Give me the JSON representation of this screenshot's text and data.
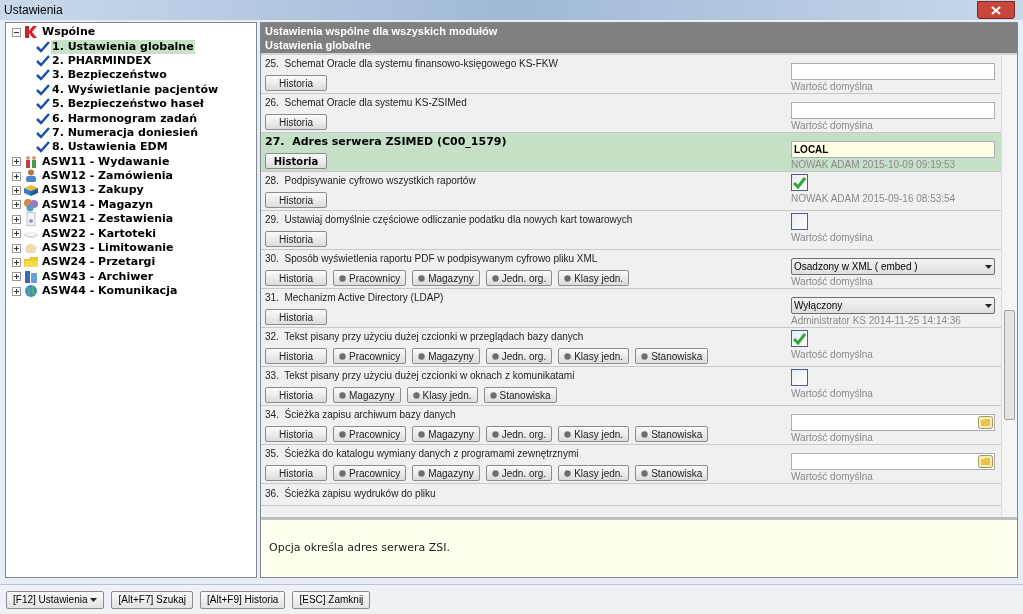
{
  "window": {
    "title": "Ustawienia"
  },
  "tree": [
    {
      "label": "Wspólne",
      "expanded": true,
      "children": [
        {
          "label": "1. Ustawienia globalne",
          "checked": true,
          "selected": true
        },
        {
          "label": "2. PHARMINDEX",
          "checked": true,
          "selected": false
        },
        {
          "label": "3. Bezpieczeństwo",
          "checked": true,
          "selected": false
        },
        {
          "label": "4. Wyświetlanie pacjentów",
          "checked": true,
          "selected": false
        },
        {
          "label": "5. Bezpieczeństwo haseł",
          "checked": true,
          "selected": false
        },
        {
          "label": "6. Harmonogram zadań",
          "checked": true,
          "selected": false
        },
        {
          "label": "7. Numeracja doniesień",
          "checked": true,
          "selected": false
        },
        {
          "label": "8. Ustawienia EDM",
          "checked": true,
          "selected": false
        }
      ]
    },
    {
      "label": "ASW11 - Wydawanie",
      "expanded": false
    },
    {
      "label": "ASW12 - Zamówienia",
      "expanded": false
    },
    {
      "label": "ASW13 - Zakupy",
      "expanded": false
    },
    {
      "label": "ASW14 - Magazyn",
      "expanded": false
    },
    {
      "label": "ASW21 - Zestawienia",
      "expanded": false
    },
    {
      "label": "ASW22 - Kartoteki",
      "expanded": false
    },
    {
      "label": "ASW23 - Limitowanie",
      "expanded": false
    },
    {
      "label": "ASW24 - Przetargi",
      "expanded": false
    },
    {
      "label": "ASW43 - Archiwer",
      "expanded": false
    },
    {
      "label": "ASW44 - Komunikacja",
      "expanded": false
    }
  ],
  "header": {
    "line_1": "Ustawienia wspólne dla wszyskich modułów",
    "line_2": "Ustawienia globalne"
  },
  "settings": [
    {
      "label": "25.  Schemat Oracle dla systemu finansowo-księgowego KS-FKW",
      "selected": false,
      "buttons": [
        {
          "label": "Historia",
          "kind": "history"
        }
      ],
      "control": {
        "kind": "text"
      },
      "note": "Wartość domyślna"
    },
    {
      "label": "26.  Schemat Oracle dla systemu KS-ZSIMed",
      "selected": false,
      "buttons": [
        {
          "label": "Historia",
          "kind": "history"
        }
      ],
      "control": {
        "kind": "text"
      },
      "note": "Wartość domyślna"
    },
    {
      "label": "27.  Adres serwera ZSIMED (C00_1579)",
      "selected": true,
      "buttons": [
        {
          "label": "Historia",
          "kind": "history"
        }
      ],
      "control": {
        "kind": "text",
        "value": "LOCAL"
      },
      "note": "NOWAK ADAM 2015-10-09 09:19:53"
    },
    {
      "label": "28.  Podpisywanie cyfrowo wszystkich raportów",
      "selected": false,
      "buttons": [
        {
          "label": "Historia",
          "kind": "history"
        }
      ],
      "control": {
        "kind": "checkbox",
        "checked": true
      },
      "note": "NOWAK ADAM 2015-09-16 08:53:54"
    },
    {
      "label": "29.  Ustawiaj domyślnie częściowe odliczanie podatku dla nowych kart towarowych",
      "selected": false,
      "buttons": [
        {
          "label": "Historia",
          "kind": "history"
        }
      ],
      "control": {
        "kind": "checkbox",
        "checked": false
      },
      "note": "Wartość domyślna"
    },
    {
      "label": "30.  Sposób wyświetlenia raportu PDF w podpisywanym cyfrowo pliku XML",
      "selected": false,
      "buttons": [
        {
          "label": "Historia",
          "kind": "history"
        },
        {
          "label": "Pracownicy",
          "kind": "scope"
        },
        {
          "label": "Magazyny",
          "kind": "scope"
        },
        {
          "label": "Jedn. org.",
          "kind": "scope"
        },
        {
          "label": "Klasy jedn.",
          "kind": "scope"
        }
      ],
      "control": {
        "kind": "select",
        "value": "Osadzony w XML ( embed )"
      },
      "note": "Wartość domyślna"
    },
    {
      "label": "31.  Mechanizm Active Directory (LDAP)",
      "selected": false,
      "buttons": [
        {
          "label": "Historia",
          "kind": "history"
        }
      ],
      "control": {
        "kind": "select",
        "value": "Wyłączony"
      },
      "note": "Administrator KS 2014-11-25 14:14:36"
    },
    {
      "label": "32.  Tekst pisany przy użyciu dużej czcionki w przeglądach bazy danych",
      "selected": false,
      "buttons": [
        {
          "label": "Historia",
          "kind": "history"
        },
        {
          "label": "Pracownicy",
          "kind": "scope"
        },
        {
          "label": "Magazyny",
          "kind": "scope"
        },
        {
          "label": "Jedn. org.",
          "kind": "scope"
        },
        {
          "label": "Klasy jedn.",
          "kind": "scope"
        },
        {
          "label": "Stanowiska",
          "kind": "scope"
        }
      ],
      "control": {
        "kind": "checkbox",
        "checked": true
      },
      "note": "Wartość domyślna"
    },
    {
      "label": "33.  Tekst pisany przy użyciu dużej czcionki w oknach z komunikatami",
      "selected": false,
      "buttons": [
        {
          "label": "Historia",
          "kind": "history"
        },
        {
          "label": "Magazyny",
          "kind": "scope"
        },
        {
          "label": "Klasy jedn.",
          "kind": "scope"
        },
        {
          "label": "Stanowiska",
          "kind": "scope"
        }
      ],
      "control": {
        "kind": "checkbox",
        "checked": false
      },
      "note": "Wartość domyślna"
    },
    {
      "label": "34.  Ścieżka zapisu archiwum bazy danych",
      "selected": false,
      "buttons": [
        {
          "label": "Historia",
          "kind": "history"
        },
        {
          "label": "Pracownicy",
          "kind": "scope"
        },
        {
          "label": "Magazyny",
          "kind": "scope"
        },
        {
          "label": "Jedn. org.",
          "kind": "scope"
        },
        {
          "label": "Klasy jedn.",
          "kind": "scope"
        },
        {
          "label": "Stanowiska",
          "kind": "scope"
        }
      ],
      "control": {
        "kind": "path"
      },
      "note": "Wartość domyślna"
    },
    {
      "label": "35.  Ścieżka do katalogu wymiany danych z programami zewnętrznymi",
      "selected": false,
      "buttons": [
        {
          "label": "Historia",
          "kind": "history"
        },
        {
          "label": "Pracownicy",
          "kind": "scope"
        },
        {
          "label": "Magazyny",
          "kind": "scope"
        },
        {
          "label": "Jedn. org.",
          "kind": "scope"
        },
        {
          "label": "Klasy jedn.",
          "kind": "scope"
        },
        {
          "label": "Stanowiska",
          "kind": "scope"
        }
      ],
      "control": {
        "kind": "path"
      },
      "note": "Wartość domyślna"
    },
    {
      "label": "36.  Ścieżka zapisu wydruków do pliku",
      "selected": false
    }
  ],
  "description": "Opcja określa adres serwera ZSI.",
  "footer_buttons": [
    {
      "label": "[F12] Ustawienia",
      "kind": "menu"
    },
    {
      "label": "[Alt+F7] Szukaj",
      "kind": "plain"
    },
    {
      "label": "[Alt+F9] Historia",
      "kind": "plain"
    },
    {
      "label": "[ESC] Zamknij",
      "kind": "plain"
    }
  ]
}
